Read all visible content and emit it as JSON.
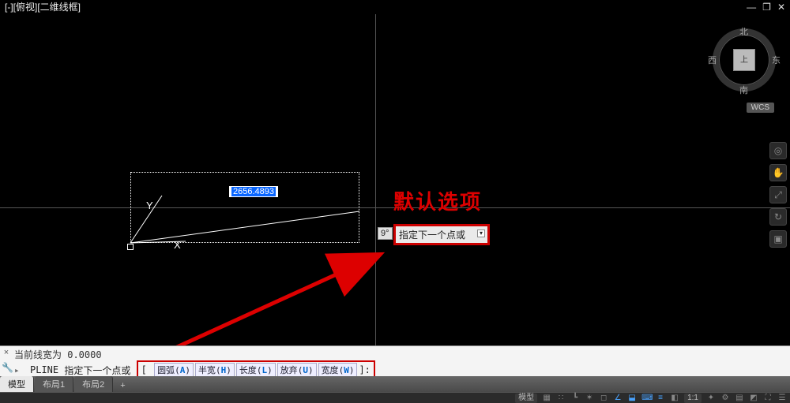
{
  "window": {
    "title": "[-][俯视][二维线框]",
    "min": "—",
    "restore": "❐",
    "close": "✕"
  },
  "viewcube": {
    "north": "北",
    "south": "南",
    "west": "西",
    "east": "东",
    "face": "上",
    "wcs": "WCS"
  },
  "drawing": {
    "length": "2656.4893",
    "angle": "9°",
    "axis_x": "X",
    "axis_y": "Y"
  },
  "dynamic_prompt": "指定下一个点或",
  "annotation": "默认选项",
  "command": {
    "history": "当前线宽为  0.0000",
    "cmd_name": "PLINE",
    "prompt": "指定下一个点或",
    "options": [
      {
        "label": "圆弧",
        "key": "A"
      },
      {
        "label": "半宽",
        "key": "H"
      },
      {
        "label": "长度",
        "key": "L"
      },
      {
        "label": "放弃",
        "key": "U"
      },
      {
        "label": "宽度",
        "key": "W"
      }
    ],
    "suffix": "]:"
  },
  "tabs": {
    "model": "模型",
    "layout1": "布局1",
    "layout2": "布局2",
    "add": "+"
  },
  "status": {
    "model": "模型",
    "scale": "1:1"
  }
}
